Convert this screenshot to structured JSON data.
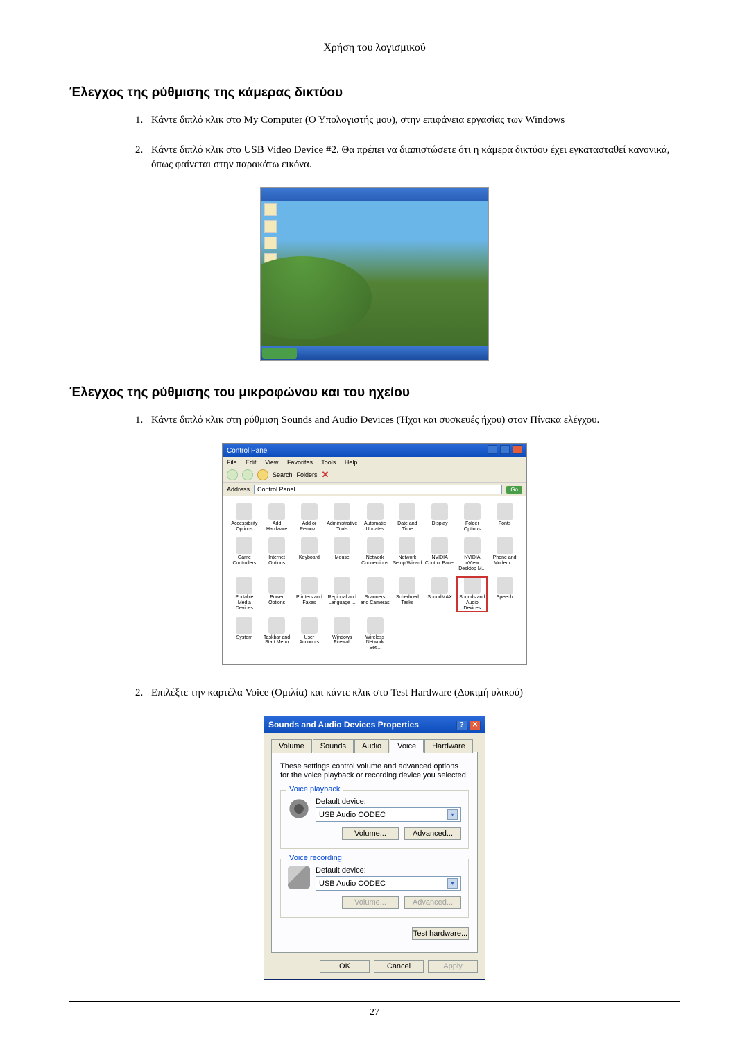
{
  "chapterHeader": "Χρήση του λογισμικού",
  "section1": {
    "title": "Έλεγχος της ρύθμισης της κάμερας δικτύου",
    "steps": [
      "Κάντε διπλό κλικ στο My Computer (Ο Υπολογιστής μου), στην επιφάνεια εργασίας των Windows",
      "Κάντε διπλό κλικ στο USB Video Device #2. Θα πρέπει να διαπιστώσετε ότι η κάμερα δικτύου έχει εγκατασταθεί κανονικά, όπως φαίνεται στην παρακάτω εικόνα."
    ]
  },
  "section2": {
    "title": "Έλεγχος της ρύθμισης του μικροφώνου και του ηχείου",
    "steps": [
      "Κάντε διπλό κλικ στη ρύθμιση Sounds and Audio Devices (Ήχοι και συσκευές ήχου) στον Πίνακα ελέγχου.",
      "Επιλέξτε την καρτέλα Voice (Ομιλία) και κάντε κλικ στο Test Hardware (Δοκιμή υλικού)"
    ]
  },
  "controlPanel": {
    "windowTitle": "Control Panel",
    "menus": [
      "File",
      "Edit",
      "View",
      "Favorites",
      "Tools",
      "Help"
    ],
    "toolbarSearch": "Search",
    "toolbarFolders": "Folders",
    "addressLabel": "Address",
    "addressValue": "Control Panel",
    "goLabel": "Go",
    "items": [
      "Accessibility Options",
      "Add Hardware",
      "Add or Remov...",
      "Administrative Tools",
      "Automatic Updates",
      "Date and Time",
      "Display",
      "Folder Options",
      "Fonts",
      "Game Controllers",
      "Internet Options",
      "Keyboard",
      "Mouse",
      "Network Connections",
      "Network Setup Wizard",
      "NVIDIA Control Panel",
      "NVIDIA nView Desktop M...",
      "Phone and Modem ...",
      "Portable Media Devices",
      "Power Options",
      "Printers and Faxes",
      "Regional and Language ...",
      "Scanners and Cameras",
      "Scheduled Tasks",
      "SoundMAX",
      "Sounds and Audio Devices",
      "Speech",
      "System",
      "Taskbar and Start Menu",
      "User Accounts",
      "Windows Firewall",
      "Wireless Network Set..."
    ],
    "highlightIndex": 25
  },
  "soundsDialog": {
    "title": "Sounds and Audio Devices Properties",
    "tabs": [
      "Volume",
      "Sounds",
      "Audio",
      "Voice",
      "Hardware"
    ],
    "activeTab": 3,
    "description": "These settings control volume and advanced options for the voice playback or recording device you selected.",
    "playback": {
      "legend": "Voice playback",
      "label": "Default device:",
      "value": "USB Audio CODEC",
      "volumeBtn": "Volume...",
      "advancedBtn": "Advanced..."
    },
    "recording": {
      "legend": "Voice recording",
      "label": "Default device:",
      "value": "USB Audio CODEC",
      "volumeBtn": "Volume...",
      "advancedBtn": "Advanced..."
    },
    "testHardwareBtn": "Test hardware...",
    "okBtn": "OK",
    "cancelBtn": "Cancel",
    "applyBtn": "Apply"
  },
  "pageNumber": "27"
}
